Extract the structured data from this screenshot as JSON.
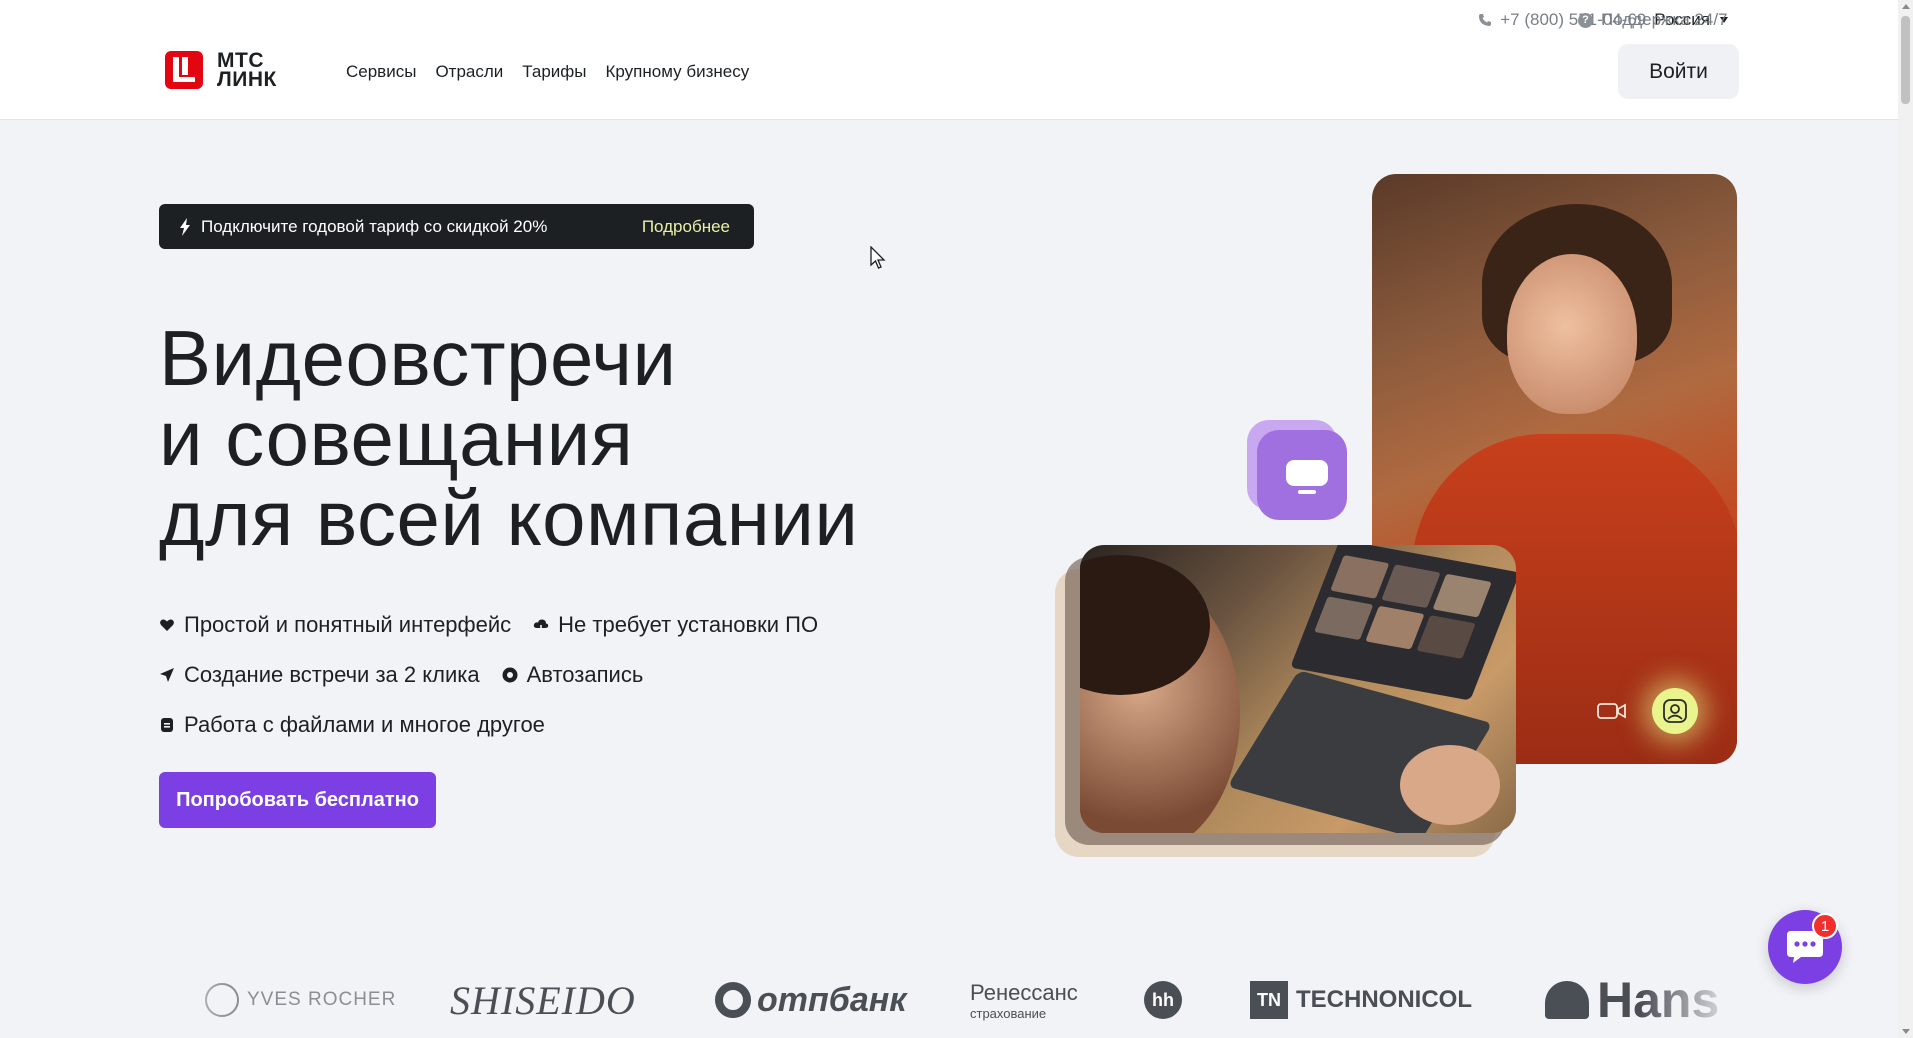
{
  "header": {
    "phone": "+7 (800) 551-04-69",
    "region": "Россия",
    "support": "Поддержка 24/7",
    "logo_line1": "МТС",
    "logo_line2": "ЛИНК",
    "nav": [
      "Сервисы",
      "Отрасли",
      "Тарифы",
      "Крупному бизнесу"
    ],
    "login_label": "Войти"
  },
  "promo": {
    "text": "Подключите годовой тариф со скидкой 20%",
    "link": "Подробнее"
  },
  "hero": {
    "title_lines": [
      "Видеовстречи",
      "и совещания",
      "для всей компании"
    ],
    "features": [
      {
        "icon": "heart-icon",
        "label": "Простой и понятный интерфейс"
      },
      {
        "icon": "cloud-download-icon",
        "label": "Не требует установки ПО"
      },
      {
        "icon": "send-icon",
        "label": "Создание встречи за 2 клика"
      },
      {
        "icon": "record-icon",
        "label": "Автозапись"
      },
      {
        "icon": "file-icon",
        "label": "Работа с файлами и многое другое"
      }
    ],
    "cta_label": "Попробовать бесплатно"
  },
  "clients": {
    "yves_rocher": "YVES ROCHER",
    "shiseido": "SHISEIDO",
    "otp": "отпбанк",
    "renaissance_1": "Ренессанс",
    "renaissance_2": "страхование",
    "hh": "hh",
    "tn_box": "TN",
    "technonicol": "TECHNONICOL",
    "hans": "Hans"
  },
  "chat": {
    "unread_count": "1"
  },
  "colors": {
    "brand_red": "#e30611",
    "accent_purple": "#7b3fe4",
    "promo_bg": "#1d2023",
    "promo_link": "#e8f0a8",
    "badge_yellow": "#e9f48c"
  }
}
